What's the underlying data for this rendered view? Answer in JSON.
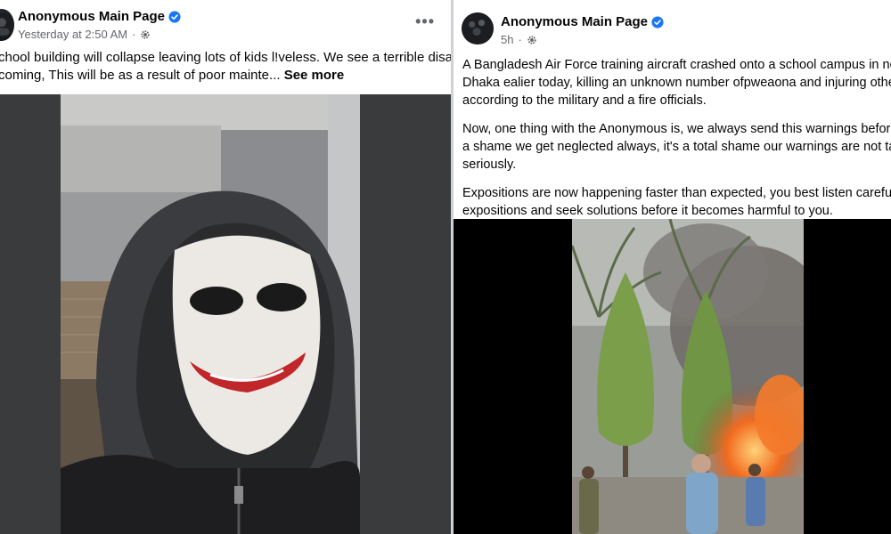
{
  "left_post": {
    "author": "Anonymous Main Page",
    "timestamp": "Yesterday at 2:50 AM",
    "more_label": "•••",
    "text_line1": "chool building will collapse leaving lots of kids l!veless. We see a terrible disaster",
    "text_line2": "coming, This will be as a result of poor mainte...",
    "see_more": "See more",
    "icons": [
      "avatar",
      "verified-badge-icon",
      "audience-gear-icon",
      "more-options-icon"
    ]
  },
  "right_post": {
    "author": "Anonymous Main Page",
    "timestamp": "5h",
    "paragraph1_line1": "A Bangladesh Air Force training aircraft crashed onto a school campus in northern",
    "paragraph1_line2": "Dhaka ealier today, killing an unknown number ofpweaona and injuring others,",
    "paragraph1_line3": "according to the military and a fire officials.",
    "paragraph2_line1": "Now, one thing with the Anonymous is, we always send this warnings before time",
    "paragraph2_line2": "a shame we get neglected always, it's a total shame our warnings are not taking",
    "paragraph2_line3": "seriously.",
    "paragraph3_line1": "Expositions are now happening faster than expected, you best listen carefully to",
    "paragraph3_line2": "expositions and seek solutions before it becomes harmful to you.",
    "icons": [
      "avatar",
      "verified-badge-icon",
      "audience-gear-icon"
    ]
  },
  "colors": {
    "verified_blue": "#1877f2",
    "meta_gray": "#65676b",
    "text": "#050505",
    "media_dark": "#3a3b3c"
  }
}
